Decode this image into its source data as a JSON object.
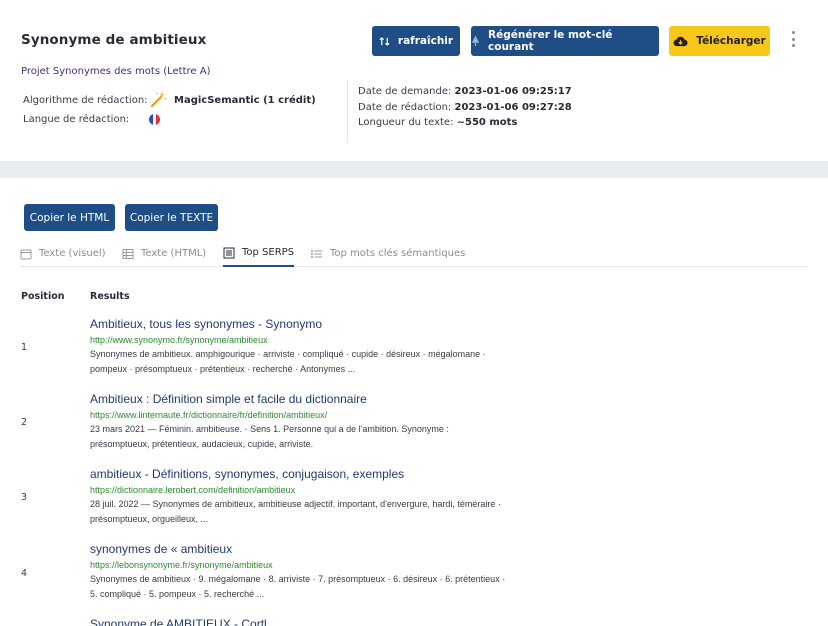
{
  "header": {
    "title": "Synonyme de ambitieux",
    "buttons": {
      "refresh": "rafraîchir",
      "regenerate": "Régénérer le mot-clé courant",
      "download": "Télécharger"
    },
    "project": "Projet Synonymes des mots (Lettre A)",
    "algorithm_label": "Algorithme de rédaction:",
    "algorithm_value": "MagicSemantic (1 crédit)",
    "language_label": "Langue de rédaction:",
    "request_date_label": "Date de demande:",
    "request_date": "2023-01-06 09:25:17",
    "writing_date_label": "Date de rédaction:",
    "writing_date": "2023-01-06 09:27:28",
    "length_label": "Longueur du texte:",
    "length_value": "~550 mots"
  },
  "actions": {
    "copy_html": "Copier le HTML",
    "copy_text": "Copier le TEXTE"
  },
  "tabs": [
    "Texte (visuel)",
    "Texte (HTML)",
    "Top SERPS",
    "Top mots clés sémantiques"
  ],
  "active_tab": "Top SERPS",
  "table": {
    "col_position": "Position",
    "col_results": "Results",
    "rows": [
      {
        "position": "1",
        "title": "Ambitieux, tous les synonymes - Synonymo",
        "url": "http://www.synonymo.fr/synonyme/ambitieux",
        "line1": "Synonymes de ambitieux. amphigourique · arriviste · compliqué · cupide · désireux · mégalomane ·",
        "line2": "pompeux · présomptueux · prétentieux · recherché · Antonymes ..."
      },
      {
        "position": "2",
        "title": "Ambitieux : Définition simple et facile du dictionnaire",
        "url": "https://www.linternaute.fr/dictionnaire/fr/definition/ambitieux/",
        "line1": "23 mars 2021 — Féminin. ambitieuse. · Sens 1. Personne qui a de l'ambition. Synonyme :",
        "line2": "présomptueux, prétentieux, audacieux, cupide, arriviste."
      },
      {
        "position": "3",
        "title": "ambitieux - Définitions, synonymes, conjugaison, exemples",
        "url": "https://dictionnaire.lerobert.com/definition/ambitieux",
        "line1": "28 juil. 2022 — Synonymes de ambitieux, ambitieuse adjectif. important, d'envergure, hardi, téméraire ·",
        "line2": "présomptueux, orgueilleux, ..."
      },
      {
        "position": "4",
        "title": "synonymes de « ambitieux",
        "url": "https://lebonsynonyme.fr/synonyme/ambitieux",
        "line1": "Synonymes de ambitieux · 9. mégalomane · 8. arriviste · 7. présomptueux · 6. désireux · 6. prétentieux ·",
        "line2": "5. compliqué · 5. pompeux · 5. recherché ..."
      },
      {
        "position": "",
        "title": "Synonyme de AMBITIEUX - Cortl",
        "url": "",
        "line1": "",
        "line2": ""
      }
    ]
  },
  "colors": {
    "primary": "#1f4e86",
    "accent": "#f7c71a",
    "link": "#1f3a6e",
    "url": "#2e8a2e"
  },
  "icons": {
    "refresh": "sort-arrows-icon",
    "regenerate": "tree-icon",
    "download": "cloud-download-icon",
    "more": "kebab-menu-icon",
    "algorithm": "magic-wand-icon",
    "language": "french-flag-icon"
  }
}
